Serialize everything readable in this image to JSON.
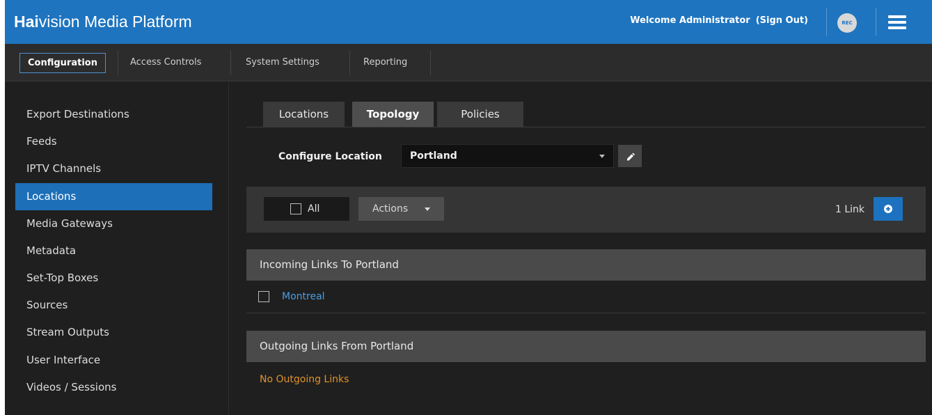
{
  "header": {
    "brand_bold": "Hai",
    "brand_rest": "vision Media Platform",
    "welcome": "Welcome Administrator",
    "sign_out": "(Sign Out)",
    "rec_label": "REC",
    "accent": "#1e74bf"
  },
  "topnav": {
    "tabs": [
      {
        "label": "Configuration",
        "active": true
      },
      {
        "label": "Access Controls"
      },
      {
        "label": "System Settings"
      },
      {
        "label": "Reporting"
      }
    ]
  },
  "sidebar": {
    "items": [
      {
        "label": "Export Destinations"
      },
      {
        "label": "Feeds"
      },
      {
        "label": "IPTV Channels"
      },
      {
        "label": "Locations",
        "active": true
      },
      {
        "label": "Media Gateways"
      },
      {
        "label": "Metadata"
      },
      {
        "label": "Set-Top Boxes"
      },
      {
        "label": "Sources"
      },
      {
        "label": "Stream Outputs"
      },
      {
        "label": "User Interface"
      },
      {
        "label": "Videos / Sessions"
      }
    ]
  },
  "main": {
    "tabs": [
      {
        "label": "Locations"
      },
      {
        "label": "Topology",
        "active": true
      },
      {
        "label": "Policies"
      }
    ],
    "configure_label": "Configure Location",
    "location_value": "Portland",
    "toolbar": {
      "all_label": "All",
      "actions_label": "Actions",
      "link_count": "1 Link"
    },
    "incoming": {
      "title": "Incoming Links To Portland",
      "links": [
        "Montreal"
      ]
    },
    "outgoing": {
      "title": "Outgoing Links From Portland",
      "empty": "No Outgoing Links"
    }
  }
}
